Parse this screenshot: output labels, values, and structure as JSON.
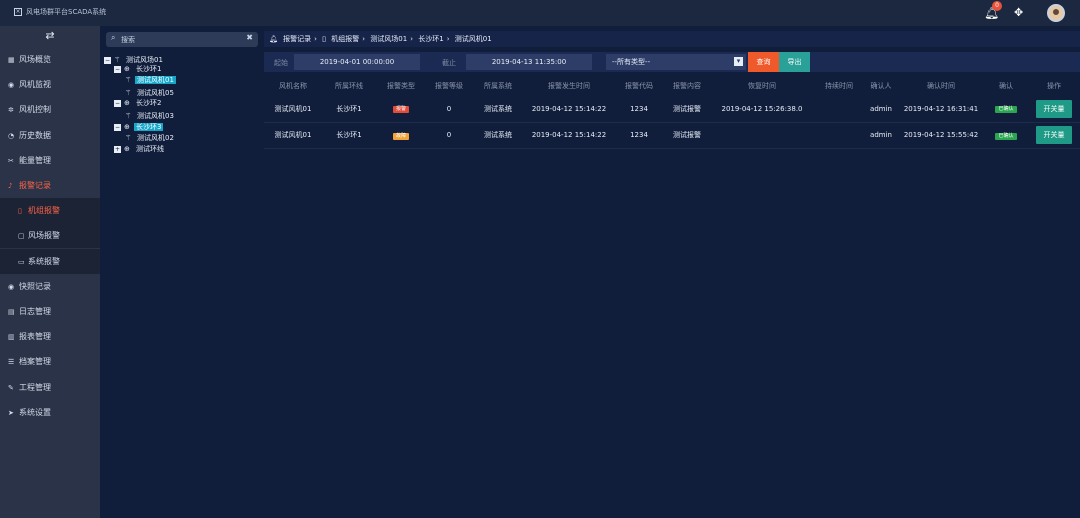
{
  "app": {
    "title": "风电场群平台SCADA系统",
    "notification_count": "0"
  },
  "sidebar": {
    "toggle_icon": "menu-toggle-icon",
    "items": [
      {
        "label": "风场概览",
        "icon": "grid-icon"
      },
      {
        "label": "风机监视",
        "icon": "camera-icon"
      },
      {
        "label": "风机控制",
        "icon": "gear-icon"
      },
      {
        "label": "历史数据",
        "icon": "pie-icon"
      },
      {
        "label": "能量管理",
        "icon": "tools-icon"
      },
      {
        "label": "报警记录",
        "icon": "bell-icon",
        "active": true
      },
      {
        "label": "快照记录",
        "icon": "camera-icon"
      },
      {
        "label": "日志管理",
        "icon": "document-icon"
      },
      {
        "label": "报表管理",
        "icon": "table-icon"
      },
      {
        "label": "档案管理",
        "icon": "list-icon"
      },
      {
        "label": "工程管理",
        "icon": "wrench-icon"
      },
      {
        "label": "系统设置",
        "icon": "send-icon"
      }
    ],
    "sub_items": [
      {
        "label": "机组报警",
        "active": true
      },
      {
        "label": "风场报警"
      },
      {
        "label": "系统报警"
      }
    ]
  },
  "tree": {
    "search_placeholder": "搜索",
    "nodes": [
      {
        "label": "测试风场01",
        "level": 0,
        "expander": "−",
        "icon": "turbine-icon"
      },
      {
        "label": "长沙环1",
        "level": 1,
        "expander": "−",
        "icon": "ring-icon"
      },
      {
        "label": "测试风机01",
        "level": 2,
        "expander": "",
        "icon": "turbine-icon",
        "selected": true
      },
      {
        "label": "测试风机05",
        "level": 2,
        "expander": "",
        "icon": "turbine-icon"
      },
      {
        "label": "长沙环2",
        "level": 1,
        "expander": "−",
        "icon": "ring-icon"
      },
      {
        "label": "测试风机03",
        "level": 2,
        "expander": "",
        "icon": "turbine-icon"
      },
      {
        "label": "长沙环3",
        "level": 1,
        "expander": "−",
        "icon": "ring-icon",
        "selected": true
      },
      {
        "label": "测试风机02",
        "level": 2,
        "expander": "",
        "icon": "turbine-icon"
      },
      {
        "label": "测试环线",
        "level": 1,
        "expander": "+",
        "icon": "ring-icon"
      }
    ]
  },
  "breadcrumb": [
    "报警记录",
    "机组报警",
    "测试风场01",
    "长沙环1",
    "测试风机01"
  ],
  "filter": {
    "start_label": "起始",
    "start_value": "2019-04-01 00:00:00",
    "end_label": "截止",
    "end_value": "2019-04-13 11:35:00",
    "type_value": "--所有类型--",
    "query_label": "查询",
    "export_label": "导出"
  },
  "table": {
    "columns": [
      "风机名称",
      "所属环线",
      "报警类型",
      "报警等级",
      "所属系统",
      "报警发生时间",
      "报警代码",
      "报警内容",
      "恢复时间",
      "持续时间",
      "确认人",
      "确认时间",
      "确认",
      "操作"
    ],
    "rows": [
      {
        "name": "测试风机01",
        "line": "长沙环1",
        "type": "报警",
        "type_color": "#e04b3a",
        "level": "0",
        "system": "测试系统",
        "time": "2019-04-12 15:14:22",
        "code": "1234",
        "content": "测试报警",
        "restore": "2019-04-12 15:26:38.0",
        "duration": "",
        "confirmer": "admin",
        "confirm_time": "2019-04-12 16:31:41",
        "confirm": "已确认",
        "action": "开关量"
      },
      {
        "name": "测试风机01",
        "line": "长沙环1",
        "type": "故障",
        "type_color": "#f2a43a",
        "level": "0",
        "system": "测试系统",
        "time": "2019-04-12 15:14:22",
        "code": "1234",
        "content": "测试报警",
        "restore": "",
        "duration": "",
        "confirmer": "admin",
        "confirm_time": "2019-04-12 15:55:42",
        "confirm": "已确认",
        "action": "开关量"
      }
    ]
  }
}
